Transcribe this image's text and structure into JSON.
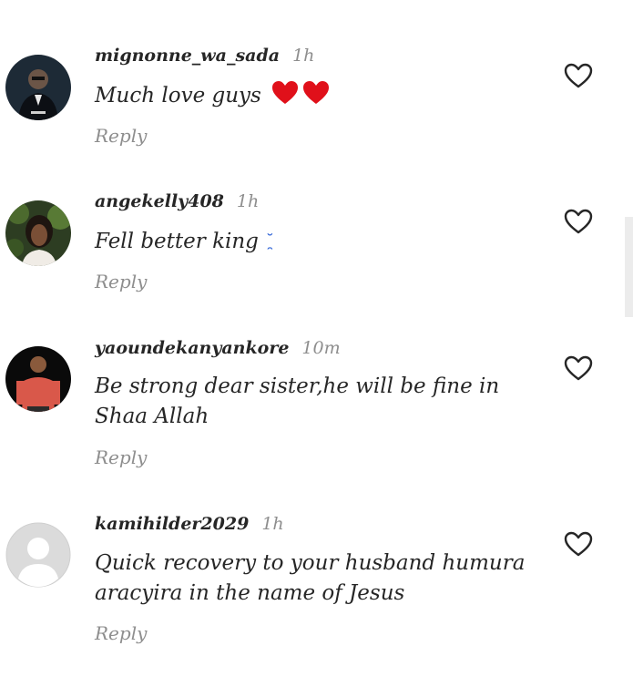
{
  "comments": [
    {
      "username": "mignonne_wa_sada",
      "time": "1h",
      "text": "Much love guys",
      "reply": "Reply",
      "avatar": "man-in-suit-photo",
      "emoji": [
        "red-heart",
        "red-heart"
      ]
    },
    {
      "username": "angekelly408",
      "time": "1h",
      "text": "Fell better king",
      "reply": "Reply",
      "avatar": "woman-portrait-photo",
      "emoji_text": "˘̯"
    },
    {
      "username": "yaoundekanyankore",
      "time": "10m",
      "text": "Be strong dear sister,he will be fine in Shaa Allah",
      "reply": "Reply",
      "avatar": "man-red-shirt-photo"
    },
    {
      "username": "kamihilder2029",
      "time": "1h",
      "text": "Quick recovery to your husband humura aracyira in the name of Jesus",
      "reply": "Reply",
      "avatar": "default-avatar"
    }
  ],
  "colors": {
    "text": "#262626",
    "secondary": "#8e8e8e",
    "heart_emoji": "#e0101a"
  }
}
